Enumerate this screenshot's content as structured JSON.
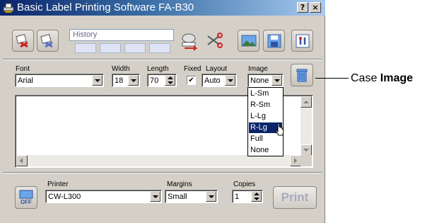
{
  "window": {
    "title": "Basic Label Printing Software FA-B30"
  },
  "titlebar_buttons": {
    "help": "?",
    "close": "×"
  },
  "history": {
    "placeholder": "History"
  },
  "font": {
    "label": "Font",
    "value": "Arial"
  },
  "width": {
    "label": "Width",
    "value": "18"
  },
  "length": {
    "label": "Length",
    "value": "70"
  },
  "fixed": {
    "label": "Fixed",
    "checked": "✔"
  },
  "layout": {
    "label": "Layout",
    "value": "Auto"
  },
  "image": {
    "label": "Image",
    "value": "None",
    "options": [
      "L-Sm",
      "R-Sm",
      "L-Lg",
      "R-Lg",
      "Full",
      "None"
    ],
    "highlighted": "R-Lg"
  },
  "printer": {
    "label": "Printer",
    "value": "CW-L300"
  },
  "margins": {
    "label": "Margins",
    "value": "Small"
  },
  "copies": {
    "label": "Copies",
    "value": "1"
  },
  "print_button": {
    "label": "Print"
  },
  "off_button": {
    "label": "OFF"
  },
  "callout": {
    "prefix": "Case ",
    "bold": "Image"
  }
}
